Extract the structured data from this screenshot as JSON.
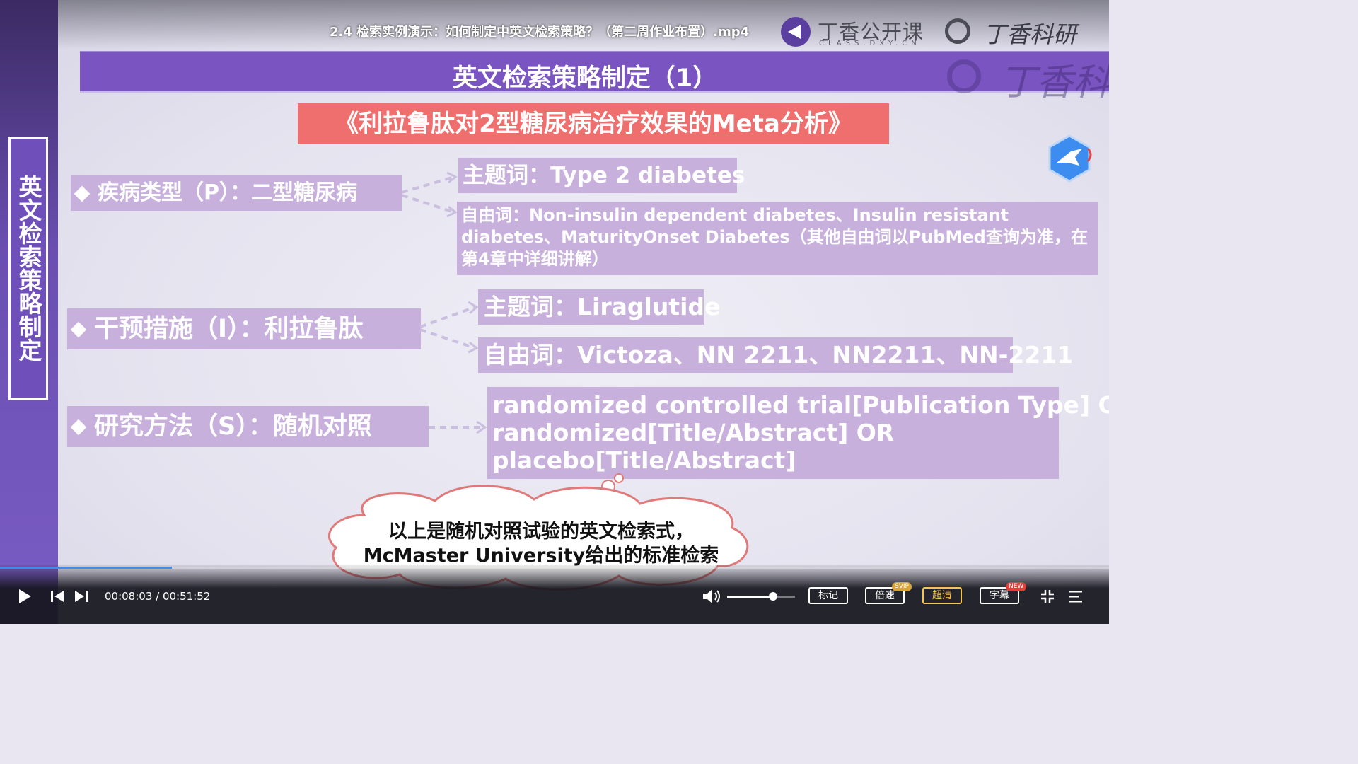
{
  "video": {
    "title": "2.4 检索实例演示：如何制定中英文检索策略？（第二周作业布置）.mp4",
    "logo_class_name": "丁香公开课",
    "logo_class_sub": "CLASS.DXY.CN",
    "logo_brand": "丁香科研"
  },
  "slide": {
    "side_title": "英文检索策略制定",
    "title": "英文检索策略制定（1）",
    "watermark": "丁香科研",
    "paper_title": "《利拉鲁肽对2型糖尿病治疗效果的Meta分析》",
    "rows": [
      {
        "label": "疾病类型（P）：二型糖尿病",
        "mesh": "主题词：Type 2 diabetes",
        "free_line1": "自由词：Non-insulin dependent diabetes、Insulin resistant",
        "free_line2": "diabetes、MaturityOnset Diabetes（其他自由词以PubMed查询为准，在",
        "free_line3": "第4章中详细讲解）"
      },
      {
        "label": "干预措施（I）：利拉鲁肽",
        "mesh": "主题词：Liraglutide",
        "free": "自由词：Victoza、NN 2211、NN2211、NN-2211"
      },
      {
        "label": "研究方法（S）：随机对照",
        "query_line1": "randomized controlled trial[Publication Type] OR",
        "query_line2": "randomized[Title/Abstract] OR",
        "query_line3": "placebo[Title/Abstract]"
      }
    ],
    "caption_line1": "以上是随机对照试验的英文检索式，",
    "caption_line2": "McMaster University给出的标准检索"
  },
  "player": {
    "time": "00:08:03 / 00:51:52",
    "progress": 0.155,
    "volume": 0.68,
    "buttons": {
      "mark": "标记",
      "speed": "倍速",
      "speed_badge": "SVIP",
      "quality": "超清",
      "subtitle": "字幕",
      "subtitle_badge": "NEW"
    }
  },
  "colors": {
    "accent_purple": "#7a55c2",
    "label_fill": "#c8b0dc",
    "paper_title_red": "#ef6f6f",
    "progress_blue": "#3d8df0"
  }
}
